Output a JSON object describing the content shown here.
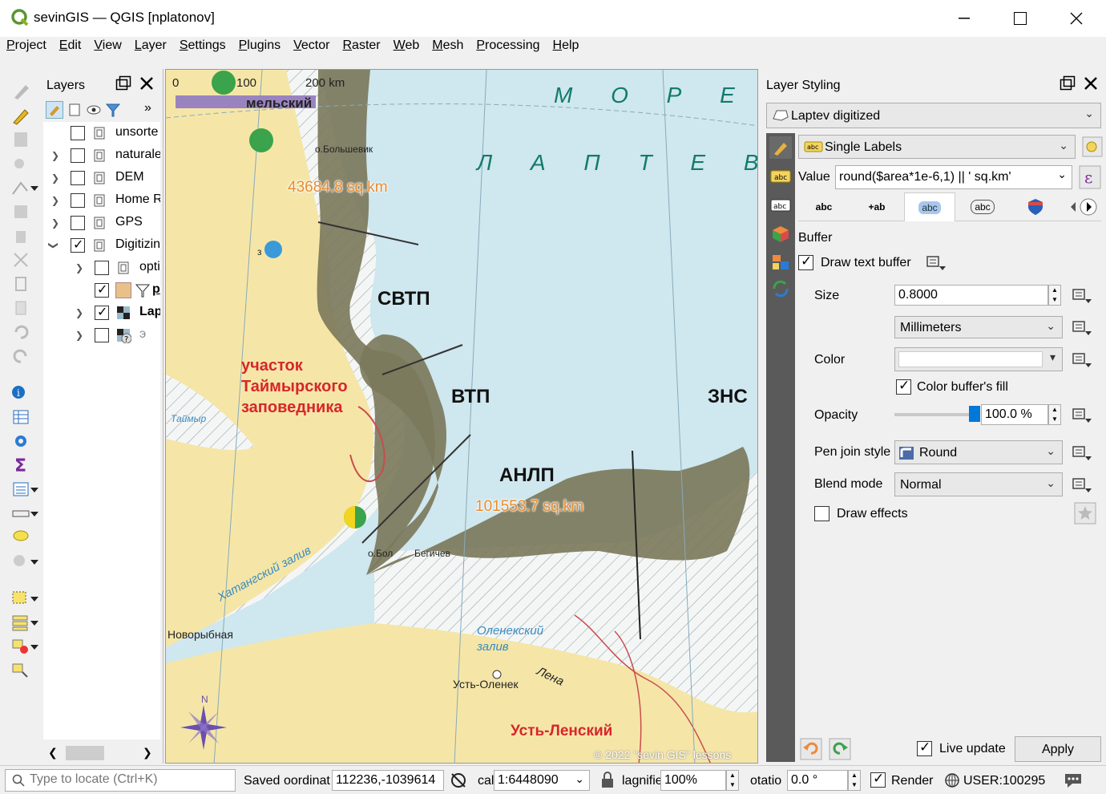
{
  "window": {
    "title": "sevinGIS — QGIS [nplatonov]"
  },
  "menu": [
    "Project",
    "Edit",
    "View",
    "Layer",
    "Settings",
    "Plugins",
    "Vector",
    "Raster",
    "Web",
    "Mesh",
    "Processing",
    "Help"
  ],
  "layers_panel": {
    "title": "Layers",
    "items": [
      {
        "label": "unsorte",
        "checked": false,
        "expandable": false
      },
      {
        "label": "naturale",
        "checked": false,
        "expandable": true
      },
      {
        "label": "DEM",
        "checked": false,
        "expandable": true
      },
      {
        "label": "Home R",
        "checked": false,
        "expandable": true
      },
      {
        "label": "GPS",
        "checked": false,
        "expandable": true
      },
      {
        "label": "Digitizin",
        "checked": true,
        "expandable": true,
        "expanded": true
      },
      {
        "label": "opti",
        "checked": false,
        "expandable": true
      },
      {
        "label": "p",
        "checked": true,
        "expandable": false
      },
      {
        "label": "Lap",
        "checked": true,
        "expandable": true
      },
      {
        "label": "э",
        "checked": false,
        "expandable": true
      }
    ]
  },
  "map": {
    "scalebar": {
      "labels": [
        "0",
        "100",
        "200 km"
      ]
    },
    "sea_labels": [
      "М О Р Е",
      "Л А П Т Е В Ы Х"
    ],
    "zone_labels": [
      "СВТП",
      "ВТП",
      "АНЛП",
      "ЗНС"
    ],
    "area_labels": [
      "43684.8 sq.km",
      "101553.7 sq.km"
    ],
    "reserve_label": [
      "участок",
      "Таймырского",
      "заповедника"
    ],
    "place_labels": [
      "мельский",
      "о.Большевик",
      "Новорыбная",
      "Усть-Оленек",
      "о.Бол",
      "Бегичев",
      "з"
    ],
    "water_labels": [
      "Хатангский залив",
      "Оленекский залив",
      "Лена",
      "Таймыр"
    ],
    "red_place_label": "Усть-Ленский",
    "copyright": "© 2022 \"sevin GIS\" lessons",
    "compass_label": "N",
    "colors": {
      "sea": "#cfe7ee",
      "land": "#f5e6a8",
      "zone": "#7c7a5c",
      "area_label": "#e88b2d"
    }
  },
  "styling_panel": {
    "title": "Layer Styling",
    "layer_combo": "Laptev digitized",
    "renderer_combo": "Single Labels",
    "value_label": "Value",
    "value_expression": "round($area*1e-6,1) || ' sq.km'",
    "tabs": [
      "abc",
      "+ab",
      "abc",
      "abc",
      "shield",
      "arrow"
    ],
    "section_title": "Buffer",
    "draw_text_buffer": {
      "label": "Draw text buffer",
      "checked": true
    },
    "size": {
      "label": "Size",
      "value": "0.8000",
      "unit": "Millimeters"
    },
    "color": {
      "label": "Color",
      "value": "#ffffff"
    },
    "color_buffer_fill": {
      "label": "Color buffer's fill",
      "checked": true
    },
    "opacity": {
      "label": "Opacity",
      "value": "100.0 %",
      "level": 1.0
    },
    "pen_join_style": {
      "label": "Pen join style",
      "value": "Round"
    },
    "blend_mode": {
      "label": "Blend mode",
      "value": "Normal"
    },
    "draw_effects": {
      "label": "Draw effects",
      "checked": false
    },
    "live_update": {
      "label": "Live update",
      "checked": true
    },
    "apply_label": "Apply"
  },
  "statusbar": {
    "locate_placeholder": "Type to locate (Ctrl+K)",
    "saved_text": "Saved",
    "coordinate_label": "oordinat",
    "coordinate_value": "112236,-1039614",
    "scale_label": "cal",
    "scale_value": "1:6448090",
    "magnifier_label": "lagnifie",
    "magnifier_value": "100%",
    "rotation_label": "otatio",
    "rotation_value": "0.0 °",
    "render_label": "Render",
    "render_checked": true,
    "crs_label": "USER:100295"
  }
}
